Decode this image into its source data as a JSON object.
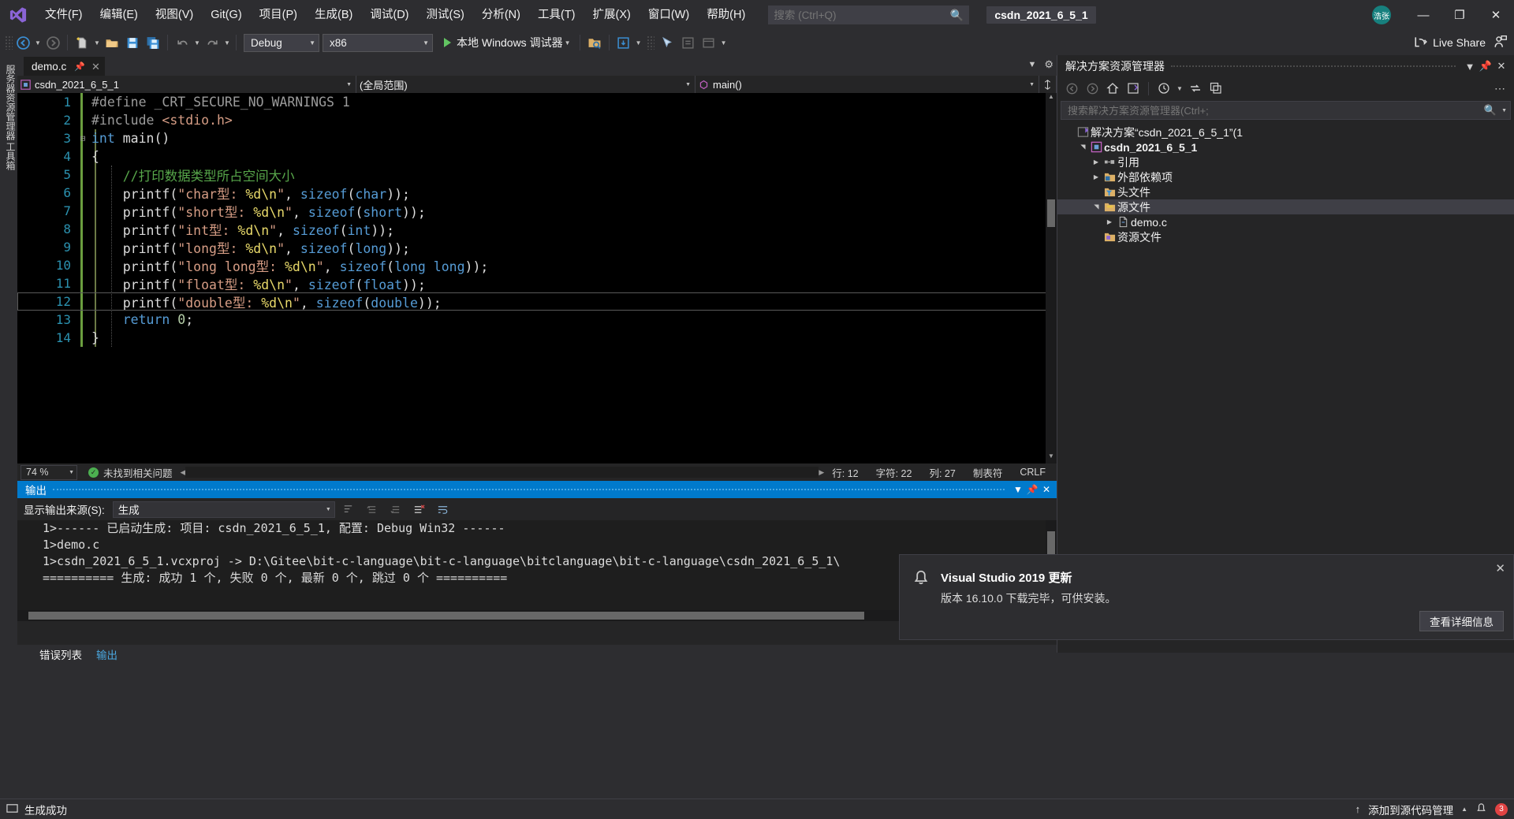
{
  "titlebar": {
    "logo_icon": "visual-studio-logo",
    "menus": [
      {
        "label": "文件(F)"
      },
      {
        "label": "编辑(E)"
      },
      {
        "label": "视图(V)"
      },
      {
        "label": "Git(G)"
      },
      {
        "label": "项目(P)"
      },
      {
        "label": "生成(B)"
      },
      {
        "label": "调试(D)"
      },
      {
        "label": "测试(S)"
      },
      {
        "label": "分析(N)"
      },
      {
        "label": "工具(T)"
      },
      {
        "label": "扩展(X)"
      },
      {
        "label": "窗口(W)"
      },
      {
        "label": "帮助(H)"
      }
    ],
    "search": {
      "placeholder": "搜索 (Ctrl+Q)",
      "value": "",
      "icon": "search-icon"
    },
    "solution_chip": "csdn_2021_6_5_1",
    "account_initials": "浩张",
    "window_buttons": {
      "minimize": "—",
      "restore": "❐",
      "close": "✕"
    }
  },
  "toolbar": {
    "nav_back_icon": "arrow-back-icon",
    "nav_forward_icon": "arrow-forward-icon",
    "new_item_icon": "new-file-icon",
    "open_icon": "open-folder-icon",
    "save_icon": "save-icon",
    "save_all_icon": "save-all-icon",
    "undo_icon": "undo-icon",
    "redo_icon": "redo-icon",
    "config_combo": {
      "value": "Debug"
    },
    "platform_combo": {
      "value": "x86"
    },
    "run_label": "本地 Windows 调试器",
    "run_icon": "play-icon",
    "live_share_label": "Live Share",
    "live_share_icon": "live-share-icon",
    "live_share_person_icon": "person-share-icon"
  },
  "left_rail": {
    "tabs": [
      {
        "label": "服务器资源管理器"
      },
      {
        "label": "工具箱"
      }
    ]
  },
  "editor": {
    "tab": {
      "name": "demo.c",
      "pin_icon": "pin-icon",
      "close_icon": "close-icon"
    },
    "tabstrip_right": {
      "chevron_icon": "chevron-down-icon",
      "settings_icon": "gear-icon"
    },
    "nav": {
      "project": "csdn_2021_6_5_1",
      "scope": "(全局范围)",
      "member": "main()",
      "project_icon": "cpp-project-icon",
      "member_icon": "method-icon",
      "split_icon": "split-view-icon"
    },
    "status": {
      "zoom": "74 %",
      "issues": "未找到相关问题",
      "issues_icon": "check-circle-icon",
      "line": "行: 12",
      "char": "字符: 22",
      "col": "列: 27",
      "insert_mode": "制表符",
      "eol": "CRLF"
    },
    "code_lines": [
      {
        "n": "1",
        "fold": "",
        "tokens": [
          {
            "t": "#define ",
            "c": "c-pre"
          },
          {
            "t": "_CRT_SECURE_NO_WARNINGS",
            "c": "c-mac"
          },
          {
            "t": " 1",
            "c": "c-mac"
          }
        ]
      },
      {
        "n": "2",
        "fold": "",
        "tokens": [
          {
            "t": "#include ",
            "c": "c-pre"
          },
          {
            "t": "<stdio.h>",
            "c": "c-inc"
          }
        ]
      },
      {
        "n": "3",
        "fold": "⊟",
        "tokens": [
          {
            "t": "int",
            "c": "c-kw"
          },
          {
            "t": " ",
            "c": "c-id"
          },
          {
            "t": "main",
            "c": "c-id"
          },
          {
            "t": "()",
            "c": "c-id"
          }
        ]
      },
      {
        "n": "4",
        "fold": "",
        "tokens": [
          {
            "t": "{",
            "c": "c-id"
          }
        ]
      },
      {
        "n": "5",
        "fold": "",
        "tokens": [
          {
            "t": "    //打印数据类型所占空间大小",
            "c": "c-cmt"
          }
        ]
      },
      {
        "n": "6",
        "fold": "",
        "tokens": [
          {
            "t": "    printf(",
            "c": "c-id"
          },
          {
            "t": "\"char型: ",
            "c": "c-str"
          },
          {
            "t": "%d",
            "c": "c-esc"
          },
          {
            "t": "\\n",
            "c": "c-esc"
          },
          {
            "t": "\"",
            "c": "c-str"
          },
          {
            "t": ", ",
            "c": "c-id"
          },
          {
            "t": "sizeof",
            "c": "c-kw"
          },
          {
            "t": "(",
            "c": "c-id"
          },
          {
            "t": "char",
            "c": "c-kw"
          },
          {
            "t": "));",
            "c": "c-id"
          }
        ]
      },
      {
        "n": "7",
        "fold": "",
        "tokens": [
          {
            "t": "    printf(",
            "c": "c-id"
          },
          {
            "t": "\"short型: ",
            "c": "c-str"
          },
          {
            "t": "%d",
            "c": "c-esc"
          },
          {
            "t": "\\n",
            "c": "c-esc"
          },
          {
            "t": "\"",
            "c": "c-str"
          },
          {
            "t": ", ",
            "c": "c-id"
          },
          {
            "t": "sizeof",
            "c": "c-kw"
          },
          {
            "t": "(",
            "c": "c-id"
          },
          {
            "t": "short",
            "c": "c-kw"
          },
          {
            "t": "));",
            "c": "c-id"
          }
        ]
      },
      {
        "n": "8",
        "fold": "",
        "tokens": [
          {
            "t": "    printf(",
            "c": "c-id"
          },
          {
            "t": "\"int型: ",
            "c": "c-str"
          },
          {
            "t": "%d",
            "c": "c-esc"
          },
          {
            "t": "\\n",
            "c": "c-esc"
          },
          {
            "t": "\"",
            "c": "c-str"
          },
          {
            "t": ", ",
            "c": "c-id"
          },
          {
            "t": "sizeof",
            "c": "c-kw"
          },
          {
            "t": "(",
            "c": "c-id"
          },
          {
            "t": "int",
            "c": "c-kw"
          },
          {
            "t": "));",
            "c": "c-id"
          }
        ]
      },
      {
        "n": "9",
        "fold": "",
        "tokens": [
          {
            "t": "    printf(",
            "c": "c-id"
          },
          {
            "t": "\"long型: ",
            "c": "c-str"
          },
          {
            "t": "%d",
            "c": "c-esc"
          },
          {
            "t": "\\n",
            "c": "c-esc"
          },
          {
            "t": "\"",
            "c": "c-str"
          },
          {
            "t": ", ",
            "c": "c-id"
          },
          {
            "t": "sizeof",
            "c": "c-kw"
          },
          {
            "t": "(",
            "c": "c-id"
          },
          {
            "t": "long",
            "c": "c-kw"
          },
          {
            "t": "));",
            "c": "c-id"
          }
        ]
      },
      {
        "n": "10",
        "fold": "",
        "tokens": [
          {
            "t": "    printf(",
            "c": "c-id"
          },
          {
            "t": "\"long long型: ",
            "c": "c-str"
          },
          {
            "t": "%d",
            "c": "c-esc"
          },
          {
            "t": "\\n",
            "c": "c-esc"
          },
          {
            "t": "\"",
            "c": "c-str"
          },
          {
            "t": ", ",
            "c": "c-id"
          },
          {
            "t": "sizeof",
            "c": "c-kw"
          },
          {
            "t": "(",
            "c": "c-id"
          },
          {
            "t": "long long",
            "c": "c-kw"
          },
          {
            "t": "));",
            "c": "c-id"
          }
        ]
      },
      {
        "n": "11",
        "fold": "",
        "tokens": [
          {
            "t": "    printf(",
            "c": "c-id"
          },
          {
            "t": "\"float型: ",
            "c": "c-str"
          },
          {
            "t": "%d",
            "c": "c-esc"
          },
          {
            "t": "\\n",
            "c": "c-esc"
          },
          {
            "t": "\"",
            "c": "c-str"
          },
          {
            "t": ", ",
            "c": "c-id"
          },
          {
            "t": "sizeof",
            "c": "c-kw"
          },
          {
            "t": "(",
            "c": "c-id"
          },
          {
            "t": "float",
            "c": "c-kw"
          },
          {
            "t": "));",
            "c": "c-id"
          }
        ]
      },
      {
        "n": "12",
        "fold": "",
        "tokens": [
          {
            "t": "    printf(",
            "c": "c-id"
          },
          {
            "t": "\"double型: ",
            "c": "c-str"
          },
          {
            "t": "%d",
            "c": "c-esc"
          },
          {
            "t": "\\n",
            "c": "c-esc"
          },
          {
            "t": "\"",
            "c": "c-str"
          },
          {
            "t": ", ",
            "c": "c-id"
          },
          {
            "t": "sizeof",
            "c": "c-kw"
          },
          {
            "t": "(",
            "c": "c-id"
          },
          {
            "t": "double",
            "c": "c-kw"
          },
          {
            "t": "));",
            "c": "c-id"
          }
        ]
      },
      {
        "n": "13",
        "fold": "",
        "tokens": [
          {
            "t": "    ",
            "c": "c-id"
          },
          {
            "t": "return",
            "c": "c-kw"
          },
          {
            "t": " ",
            "c": "c-id"
          },
          {
            "t": "0",
            "c": "c-num"
          },
          {
            "t": ";",
            "c": "c-id"
          }
        ]
      },
      {
        "n": "14",
        "fold": "",
        "tokens": [
          {
            "t": "}",
            "c": "c-id"
          }
        ]
      }
    ],
    "current_line_index": 11
  },
  "solution_explorer": {
    "title": "解决方案资源管理器",
    "title_icons": {
      "chevron": "chevron-down-icon",
      "pin": "pin-icon",
      "close": "close-icon"
    },
    "toolbar_icons": [
      "arrow-back-icon",
      "arrow-forward-icon",
      "home-icon",
      "sync-views-icon",
      "pending-changes-icon",
      "refresh-icon",
      "show-all-files-icon",
      "overflow-icon"
    ],
    "search": {
      "placeholder": "搜索解决方案资源管理器(Ctrl+;",
      "value": "",
      "icon": "search-icon"
    },
    "tree": [
      {
        "indent": 0,
        "arrow": "",
        "icon": "solution-icon",
        "label": "解决方案“csdn_2021_6_5_1”(1 ",
        "bold": false,
        "selected": false
      },
      {
        "indent": 1,
        "arrow": "▲",
        "icon": "cpp-project-icon",
        "label": "csdn_2021_6_5_1",
        "bold": true,
        "selected": false
      },
      {
        "indent": 2,
        "arrow": "▶",
        "icon": "references-icon",
        "label": "引用",
        "bold": false,
        "selected": false
      },
      {
        "indent": 2,
        "arrow": "▶",
        "icon": "ext-deps-icon",
        "label": "外部依赖项",
        "bold": false,
        "selected": false
      },
      {
        "indent": 2,
        "arrow": "",
        "icon": "header-folder-icon",
        "label": "头文件",
        "bold": false,
        "selected": false
      },
      {
        "indent": 2,
        "arrow": "▲",
        "icon": "source-folder-icon",
        "label": "源文件",
        "bold": false,
        "selected": true
      },
      {
        "indent": 3,
        "arrow": "▶",
        "icon": "c-file-icon",
        "label": "demo.c",
        "bold": false,
        "selected": false
      },
      {
        "indent": 2,
        "arrow": "",
        "icon": "resource-folder-icon",
        "label": "资源文件",
        "bold": false,
        "selected": false
      }
    ]
  },
  "output_panel": {
    "title": "输出",
    "title_icons": {
      "chevron": "chevron-down-icon",
      "pin": "pin-icon",
      "close": "close-icon"
    },
    "source_label": "显示输出来源(S):",
    "source_value": "生成",
    "toolbar_icons": [
      "find-message-icon",
      "prev-message-icon",
      "next-message-icon",
      "clear-all-icon",
      "word-wrap-icon"
    ],
    "lines": [
      "1>------ 已启动生成: 项目: csdn_2021_6_5_1, 配置: Debug Win32 ------",
      "1>demo.c",
      "1>csdn_2021_6_5_1.vcxproj -> D:\\Gitee\\bit-c-language\\bit-c-language\\bitclanguage\\bit-c-language\\csdn_2021_6_5_1\\",
      "========== 生成: 成功 1 个, 失败 0 个, 最新 0 个, 跳过 0 个 =========="
    ]
  },
  "bottom_tabs": [
    {
      "label": "错误列表",
      "active": false
    },
    {
      "label": "输出",
      "active": true
    }
  ],
  "toast": {
    "icon": "bell-icon",
    "title": "Visual Studio 2019 更新",
    "message": "版本 16.10.0 下载完毕，可供安装。",
    "action_label": "查看详细信息",
    "close_icon": "close-icon"
  },
  "statusbar": {
    "icon": "ready-icon",
    "text": "生成成功",
    "source_control_label": "添加到源代码管理",
    "source_control_chevron": "chevron-up-icon",
    "notify_icon": "bell-icon",
    "notify_count": "3",
    "upload_icon": "arrow-up-icon"
  },
  "colors": {
    "accent_blue": "#007acc",
    "chrome": "#2d2d30",
    "panel": "#252526",
    "editor_bg": "#000000",
    "keyword": "#569cd6",
    "string": "#d69d85",
    "comment": "#57a64a",
    "linenumber": "#2b91af",
    "escape": "#e8d96a",
    "number": "#b5cea8"
  }
}
